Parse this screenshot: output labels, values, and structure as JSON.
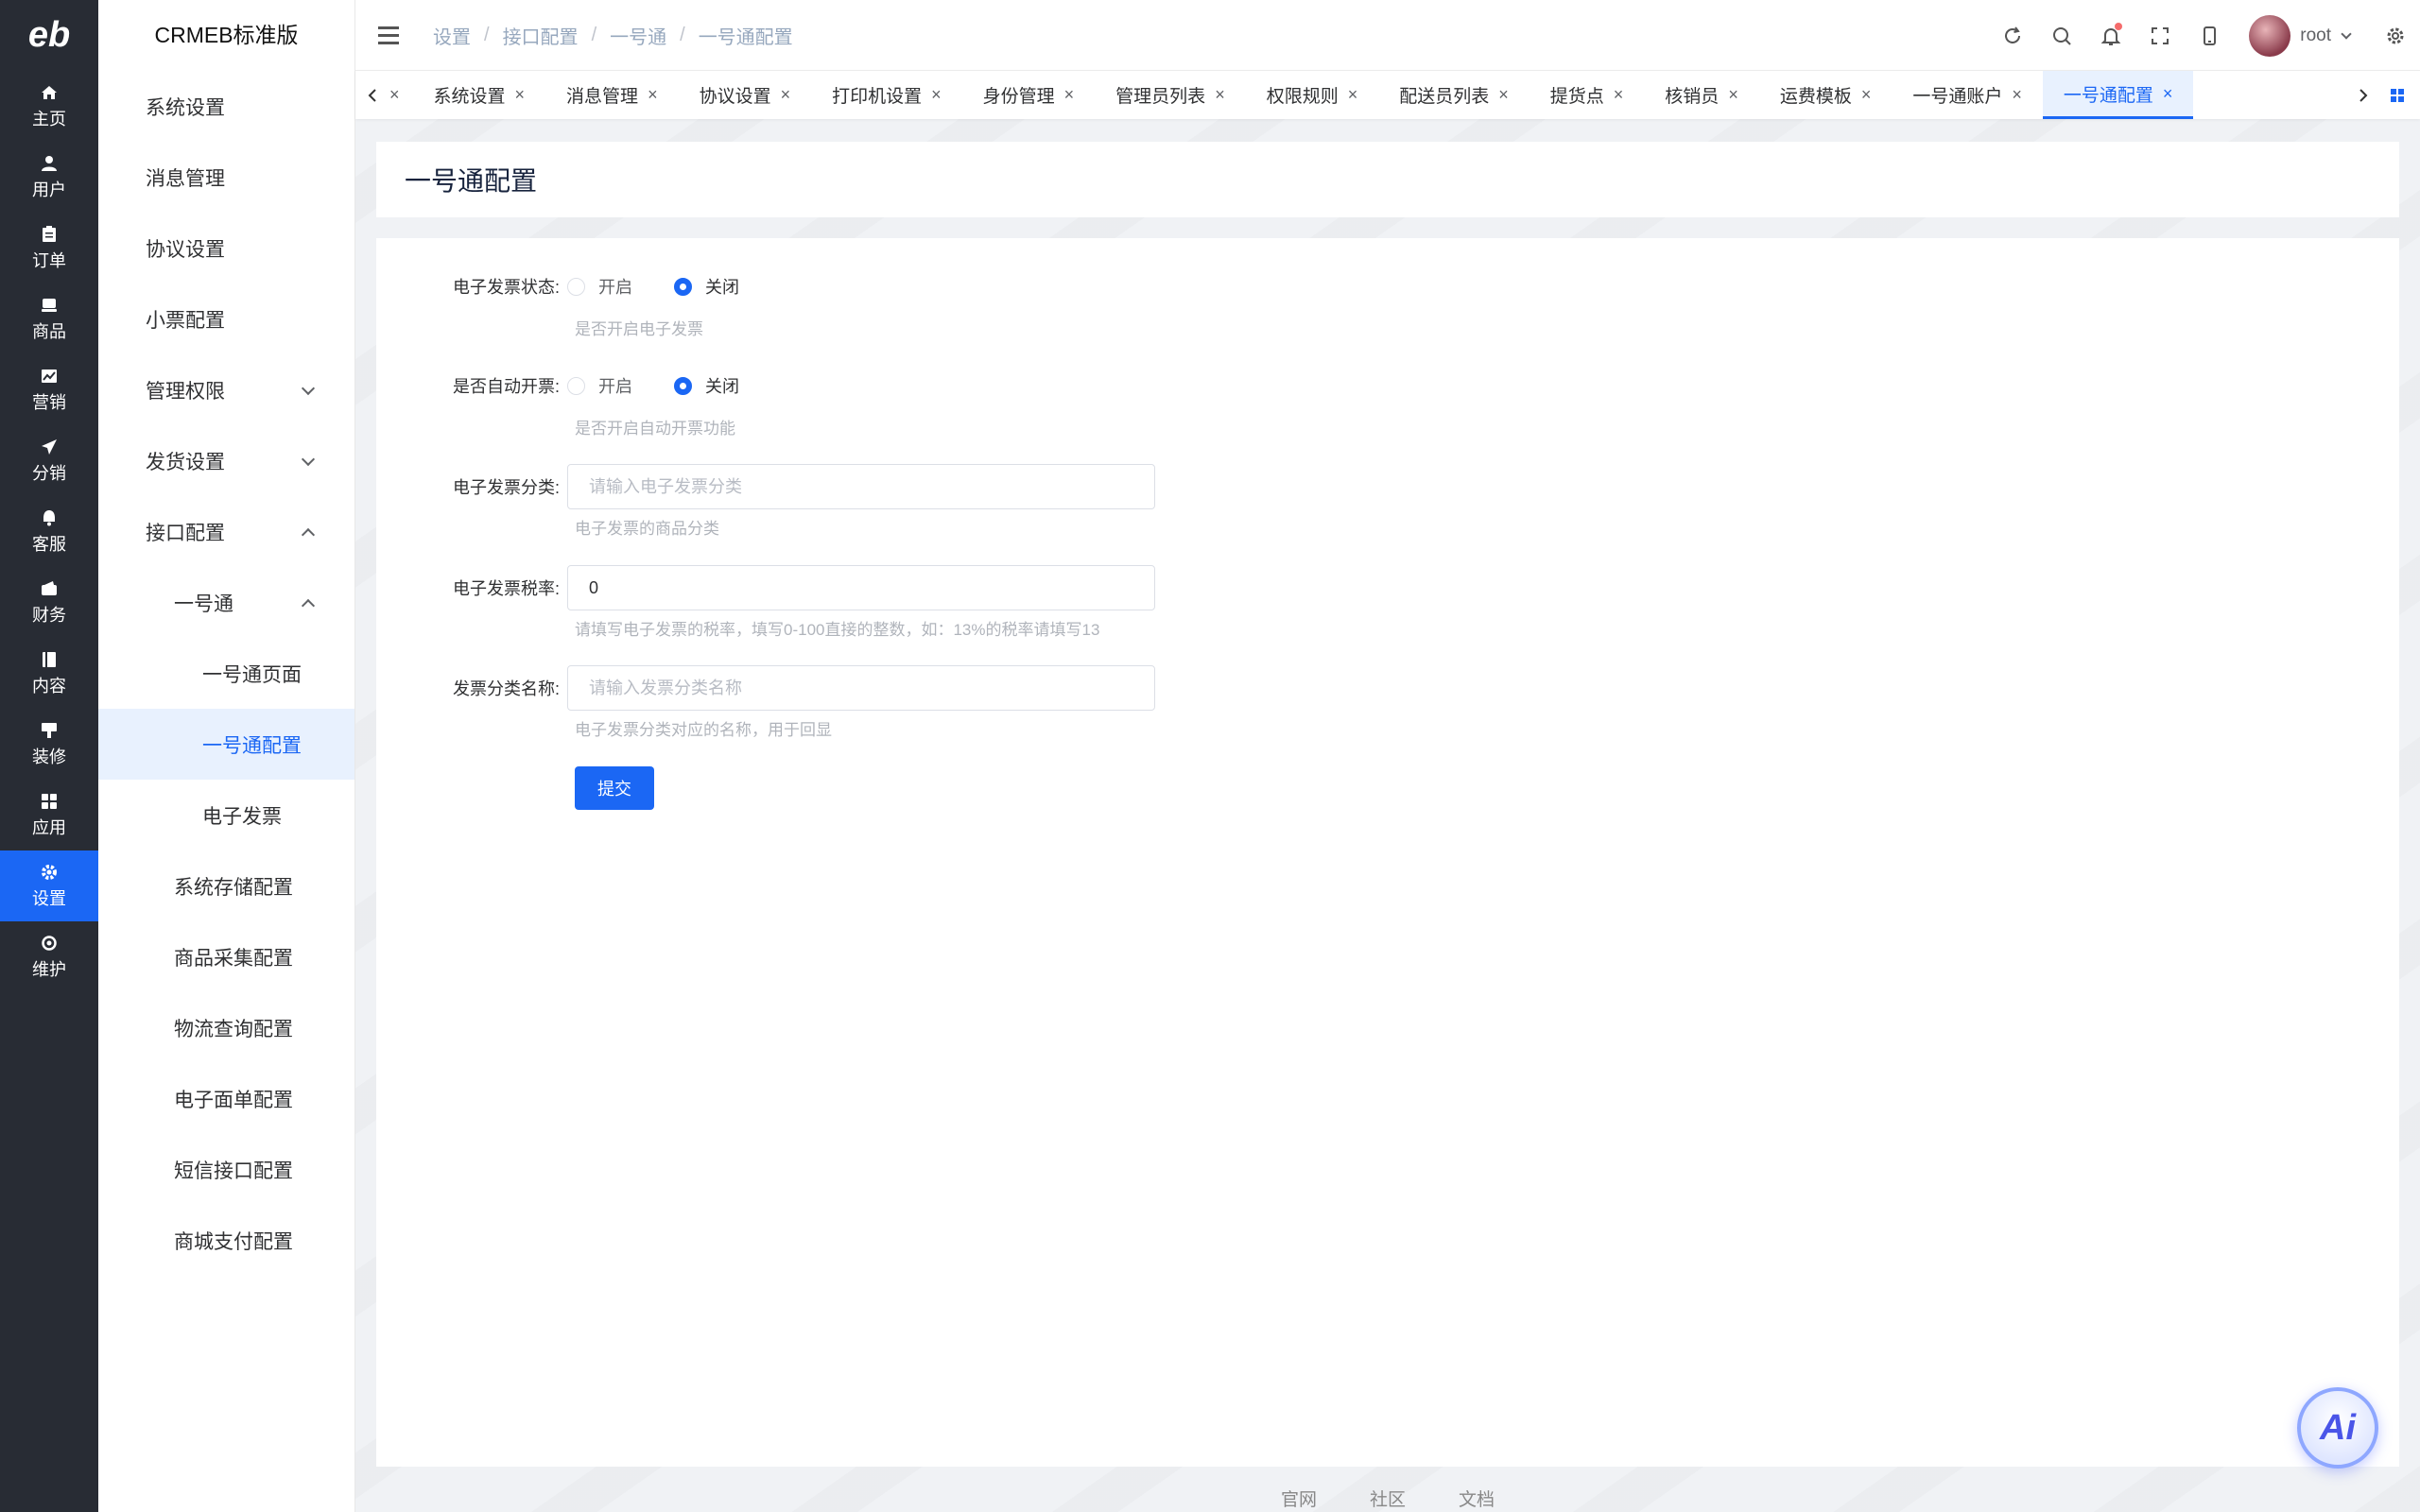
{
  "rail": {
    "logo": "eb",
    "items": [
      {
        "label": "主页",
        "icon": "home-icon"
      },
      {
        "label": "用户",
        "icon": "user-icon"
      },
      {
        "label": "订单",
        "icon": "order-icon"
      },
      {
        "label": "商品",
        "icon": "product-icon"
      },
      {
        "label": "营销",
        "icon": "marketing-icon"
      },
      {
        "label": "分销",
        "icon": "distribution-icon"
      },
      {
        "label": "客服",
        "icon": "service-icon"
      },
      {
        "label": "财务",
        "icon": "finance-icon"
      },
      {
        "label": "内容",
        "icon": "content-icon"
      },
      {
        "label": "装修",
        "icon": "decoration-icon"
      },
      {
        "label": "应用",
        "icon": "apps-icon"
      },
      {
        "label": "设置",
        "icon": "settings-icon",
        "active": true
      },
      {
        "label": "维护",
        "icon": "maintenance-icon"
      }
    ]
  },
  "sidebar": {
    "title": "CRMEB标准版",
    "items": [
      {
        "label": "系统设置"
      },
      {
        "label": "消息管理"
      },
      {
        "label": "协议设置"
      },
      {
        "label": "小票配置"
      },
      {
        "label": "管理权限"
      },
      {
        "label": "发货设置"
      },
      {
        "label": "接口配置"
      },
      {
        "label": "一号通"
      },
      {
        "label": "一号通页面"
      },
      {
        "label": "一号通配置"
      },
      {
        "label": "电子发票"
      },
      {
        "label": "系统存储配置"
      },
      {
        "label": "商品采集配置"
      },
      {
        "label": "物流查询配置"
      },
      {
        "label": "电子面单配置"
      },
      {
        "label": "短信接口配置"
      },
      {
        "label": "商城支付配置"
      }
    ]
  },
  "header": {
    "breadcrumb": [
      "设置",
      "接口配置",
      "一号通",
      "一号通配置"
    ],
    "separator": "/",
    "user": "root"
  },
  "tags": [
    {
      "label": "系统设置"
    },
    {
      "label": "消息管理"
    },
    {
      "label": "协议设置"
    },
    {
      "label": "打印机设置"
    },
    {
      "label": "身份管理"
    },
    {
      "label": "管理员列表"
    },
    {
      "label": "权限规则"
    },
    {
      "label": "配送员列表"
    },
    {
      "label": "提货点"
    },
    {
      "label": "核销员"
    },
    {
      "label": "运费模板"
    },
    {
      "label": "一号通账户"
    },
    {
      "label": "一号通配置",
      "active": true
    }
  ],
  "tag_close": "×",
  "page": {
    "title": "一号通配置"
  },
  "form": {
    "invoice_status": {
      "label": "电子发票状态:",
      "on": "开启",
      "off": "关闭",
      "selected": "off",
      "tip": "是否开启电子发票"
    },
    "auto_invoice": {
      "label": "是否自动开票:",
      "on": "开启",
      "off": "关闭",
      "selected": "off",
      "tip": "是否开启自动开票功能"
    },
    "invoice_category": {
      "label": "电子发票分类:",
      "placeholder": "请输入电子发票分类",
      "value": "",
      "tip": "电子发票的商品分类"
    },
    "tax_rate": {
      "label": "电子发票税率:",
      "value": "0",
      "tip": "请填写电子发票的税率，填写0-100直接的整数，如：13%的税率请填写13"
    },
    "category_name": {
      "label": "发票分类名称:",
      "placeholder": "请输入发票分类名称",
      "value": "",
      "tip": "电子发票分类对应的名称，用于回显"
    },
    "submit": "提交"
  },
  "footer": [
    "官网",
    "社区",
    "文档"
  ],
  "ai_badge": "Ai",
  "colors": {
    "accent": "#1b67f4",
    "rail_bg": "#282c34"
  }
}
